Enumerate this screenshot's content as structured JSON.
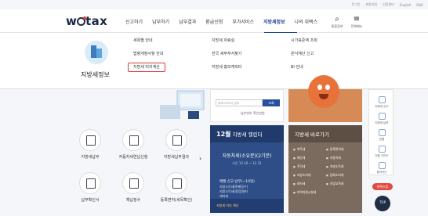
{
  "util": [
    "로그인",
    "회원가입",
    "인증센터",
    "English",
    "ENG"
  ],
  "logo": {
    "prefix": "w",
    "suffix": "tax"
  },
  "gnb": [
    "신고하기",
    "납부하기",
    "납부결과",
    "환급신청",
    "부가서비스",
    "지방세정보",
    "나의 위택스"
  ],
  "header_icons": [
    {
      "label": "통합검색",
      "icon": "search-icon"
    },
    {
      "label": "전체메뉴",
      "icon": "menu-icon"
    }
  ],
  "mega": {
    "title": "지방세정보",
    "col1": [
      "세목별 안내",
      "법령개정사항 안내",
      "지방세 미리계산"
    ],
    "col2": [
      "지방세 자료실",
      "전국 세무부서찾기",
      "지방세 홍보캐릭터"
    ],
    "col3": [
      "시가표준액 조회",
      "온닉재산 신고",
      "BI 안내"
    ]
  },
  "login": {
    "placeholder": "위택스아이디 입력",
    "button": "조회",
    "link": "납부번호 확인방법"
  },
  "services": [
    "지방세납부",
    "자동차세연납신청",
    "지방세납부결과",
    "납부확인서",
    "체납징수",
    "등록면허(세목확인)"
  ],
  "calendar": {
    "month": "12월",
    "title": "지방세 캘린더",
    "item": "자동차세(소유분)(2기분)",
    "period": "기간 12.16 ~ 12.31",
    "body_title": "매월 신고·납부(~10일)",
    "body": [
      "지방소득세(특별징수)",
      "지방소득세(종업원분)",
      "레저세",
      "담배소비세"
    ],
    "footer": "지방세 미리 계산"
  },
  "quick": {
    "title": "지방세 바로가기",
    "items": [
      "취득세",
      "등록면허세",
      "재산세",
      "자동차세",
      "주민세",
      "지방소득세",
      "지방소비세",
      "담배소비세",
      "레저세",
      "지방교육세",
      "지역자원시설세"
    ]
  },
  "right_panel": [
    "지방세 신고",
    "지방세 납부",
    "민원",
    "이용 가이드",
    "찾아가는"
  ],
  "badge": "위택스몽",
  "top_btn": "TOP"
}
